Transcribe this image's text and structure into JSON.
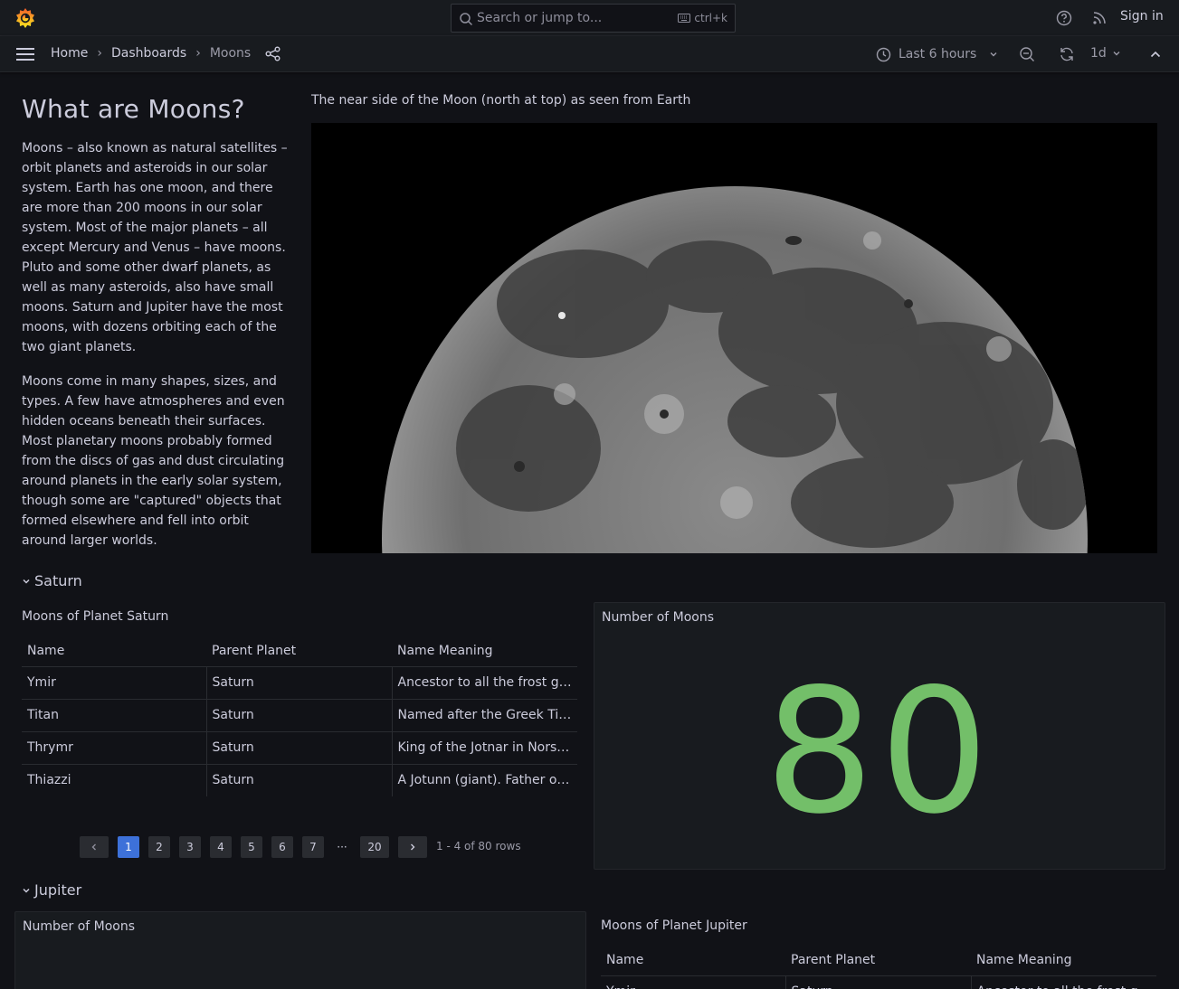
{
  "topbar": {
    "search_placeholder": "Search or jump to...",
    "search_shortcut": "ctrl+k",
    "sign_in": "Sign in"
  },
  "navbar": {
    "breadcrumbs": [
      "Home",
      "Dashboards",
      "Moons"
    ],
    "time_range": "Last 6 hours",
    "refresh_interval": "1d"
  },
  "intro": {
    "title": "What are Moons?",
    "paragraphs": [
      "Moons – also known as natural satellites – orbit planets and asteroids in our solar system. Earth has one moon, and there are more than 200 moons in our solar system. Most of the major planets – all except Mercury and Venus – have moons. Pluto and some other dwarf planets, as well as many asteroids, also have small moons. Saturn and Jupiter have the most moons, with dozens orbiting each of the two giant planets.",
      "Moons come in many shapes, sizes, and types. A few have atmospheres and even hidden oceans beneath their surfaces. Most planetary moons probably formed from the discs of gas and dust circulating around planets in the early solar system, though some are \"captured\" objects that formed elsewhere and fell into orbit around larger worlds."
    ]
  },
  "image_panel": {
    "title": "The near side of the Moon (north at top) as seen from Earth"
  },
  "saturn": {
    "row_title": "Saturn",
    "table_title": "Moons of Planet Saturn",
    "columns": [
      "Name",
      "Parent Planet",
      "Name Meaning"
    ],
    "rows": [
      [
        "Ymir",
        "Saturn",
        "Ancestor to all the frost giants"
      ],
      [
        "Titan",
        "Saturn",
        "Named after the Greek Titans"
      ],
      [
        "Thrymr",
        "Saturn",
        "King of the Jotnar in Norse mythology"
      ],
      [
        "Thiazzi",
        "Saturn",
        "A Jotunn (giant). Father of Skadi"
      ]
    ],
    "pages": [
      "1",
      "2",
      "3",
      "4",
      "5",
      "6",
      "7",
      "20"
    ],
    "active_page": "1",
    "ellipsis": "···",
    "row_info": "1 - 4 of 80 rows",
    "stat_title": "Number of Moons",
    "stat_value": "80"
  },
  "jupiter": {
    "row_title": "Jupiter",
    "stat_title": "Number of Moons",
    "table_title": "Moons of Planet Jupiter",
    "columns": [
      "Name",
      "Parent Planet",
      "Name Meaning"
    ],
    "rows": [
      [
        "Ymir",
        "Saturn",
        "Ancestor to all the frost giants"
      ]
    ]
  },
  "colors": {
    "background": "#111217",
    "panel": "#181b1f",
    "stat_green": "#73bf69",
    "active_page": "#3d71d9",
    "logo_orange": "#f46800"
  },
  "icons": [
    "grafana-logo-icon",
    "search-icon",
    "keyboard-icon",
    "help-icon",
    "rss-icon",
    "menu-icon",
    "share-icon",
    "clock-icon",
    "chevron-down-icon",
    "zoom-out-icon",
    "refresh-icon",
    "chevron-up-icon",
    "chevron-left-icon",
    "chevron-right-icon"
  ]
}
